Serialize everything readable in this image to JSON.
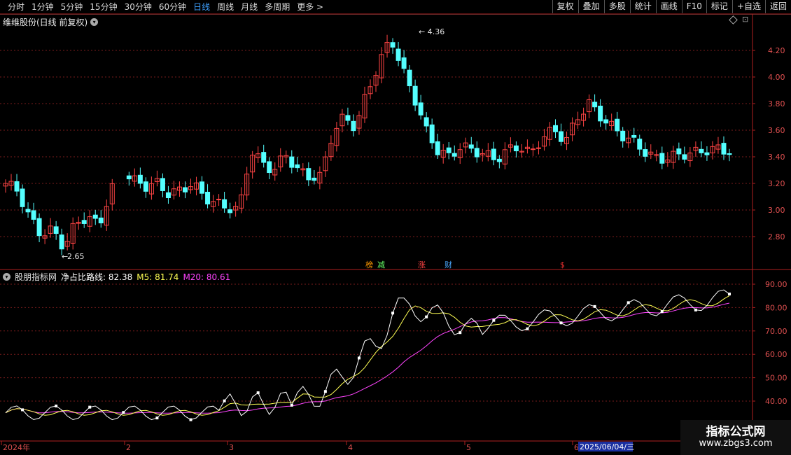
{
  "toolbar": {
    "periods": [
      "分时",
      "1分钟",
      "5分钟",
      "15分钟",
      "30分钟",
      "60分钟",
      "日线",
      "周线",
      "月线",
      "多周期",
      "更多 >"
    ],
    "active_period": "日线",
    "tools": [
      "复权",
      "叠加",
      "多股",
      "统计",
      "画线",
      "F10",
      "标记",
      "+自选",
      "返回"
    ]
  },
  "main_chart": {
    "title": "维维股份(日线 前复权)",
    "price_ticks": [
      "4.20",
      "4.00",
      "3.80",
      "3.60",
      "3.40",
      "3.20",
      "3.00",
      "2.80"
    ],
    "high_label": "4.36",
    "low_label": "2.65",
    "markers": [
      {
        "text": "榜",
        "color": "#ff9900"
      },
      {
        "text": "减",
        "color": "#66ff66"
      },
      {
        "text": "涨",
        "color": "#ff4444"
      },
      {
        "text": "财",
        "color": "#4aa8ff"
      },
      {
        "text": "$",
        "color": "#ff3333"
      }
    ]
  },
  "indicator": {
    "name": "股朋指标网",
    "line_label": "净占比路线: 82.38",
    "m5_label": "M5: 81.74",
    "m20_label": "M20: 80.61",
    "ticks": [
      "90.00",
      "80.00",
      "70.00",
      "60.00",
      "50.00",
      "40.00"
    ]
  },
  "time_axis": {
    "labels": [
      "2024年",
      "2",
      "3",
      "4",
      "5",
      "6"
    ],
    "cursor_date": "2025/06/04/三"
  },
  "watermark": {
    "line1": "指标公式网",
    "line2": "www.zbgs3.com"
  },
  "colors": {
    "up": "#ff4444",
    "down": "#54ffff",
    "grid": "#7a1c1c",
    "axis": "#b02020"
  }
}
